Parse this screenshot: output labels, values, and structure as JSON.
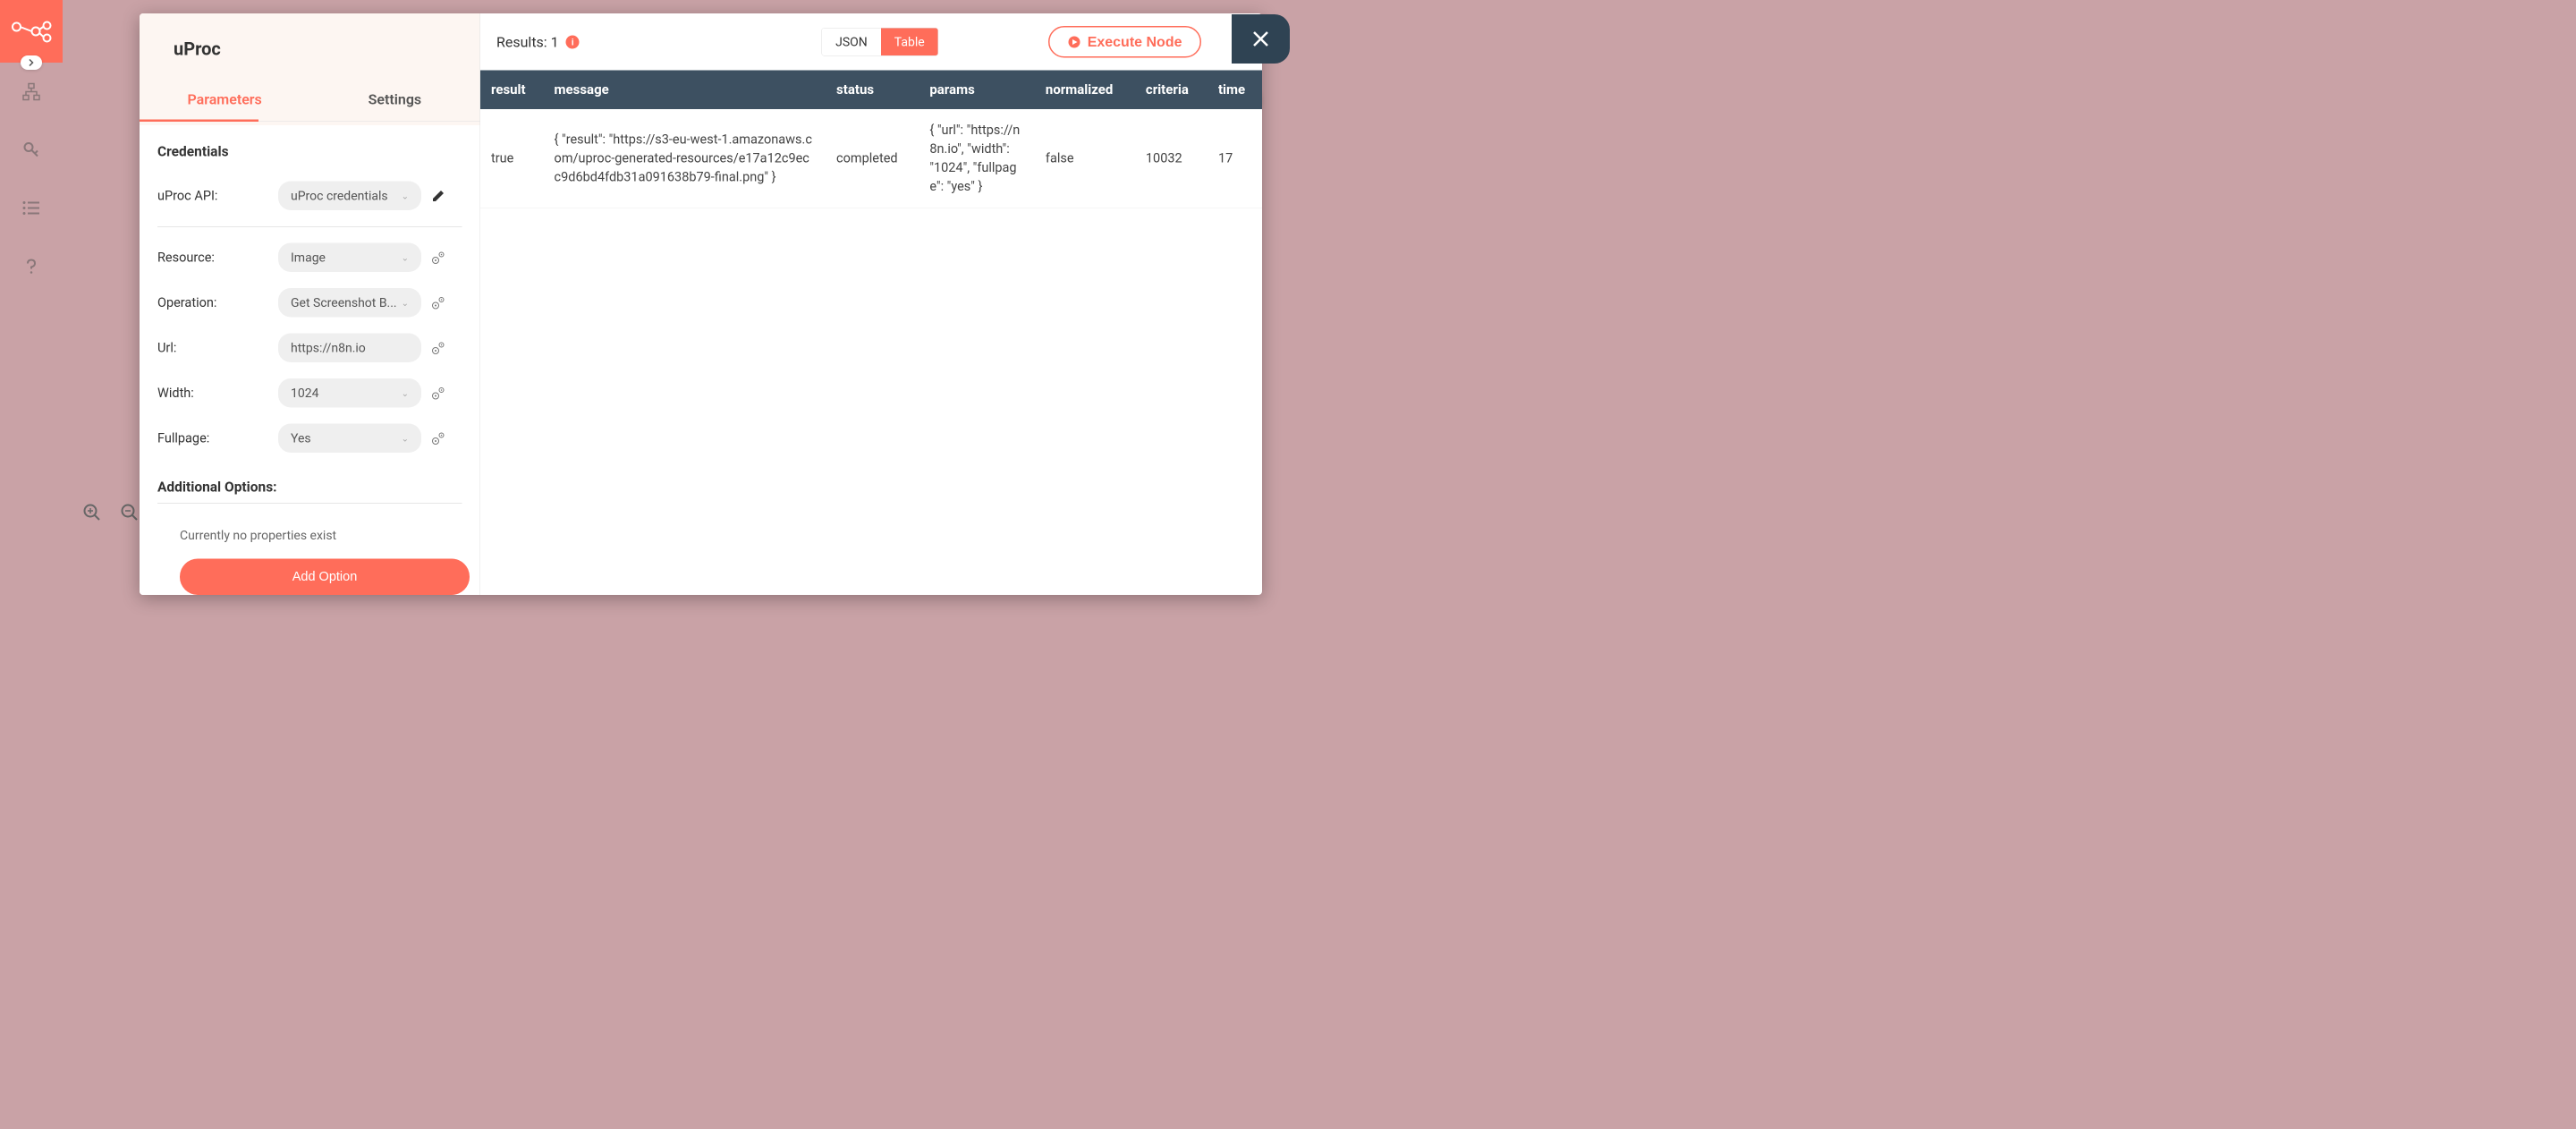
{
  "sidebar": {
    "items": [
      "workflow",
      "hierarchy",
      "credentials",
      "executions",
      "help"
    ]
  },
  "modal": {
    "title": "uProc",
    "tabs": {
      "parameters": "Parameters",
      "settings": "Settings"
    },
    "credentials": {
      "section_label": "Credentials",
      "api_label": "uProc API:",
      "api_value": "uProc credentials"
    },
    "fields": {
      "resource": {
        "label": "Resource:",
        "value": "Image"
      },
      "operation": {
        "label": "Operation:",
        "value": "Get Screenshot B..."
      },
      "url": {
        "label": "Url:",
        "value": "https://n8n.io"
      },
      "width": {
        "label": "Width:",
        "value": "1024"
      },
      "fullpage": {
        "label": "Fullpage:",
        "value": "Yes"
      }
    },
    "additional": {
      "label": "Additional Options:",
      "empty_text": "Currently no properties exist",
      "add_button": "Add Option"
    }
  },
  "results": {
    "label": "Results: 1",
    "view_json": "JSON",
    "view_table": "Table",
    "execute_button": "Execute Node",
    "columns": [
      "result",
      "message",
      "status",
      "params",
      "normalized",
      "criteria",
      "time"
    ],
    "rows": [
      {
        "result": "true",
        "message": "{ \"result\": \"https://s3-eu-west-1.amazonaws.com/uproc-generated-resources/e17a12c9ecc9d6bd4fdb31a091638b79-final.png\" }",
        "status": "completed",
        "params": "{ \"url\": \"https://n8n.io\", \"width\": \"1024\", \"fullpage\": \"yes\" }",
        "normalized": "false",
        "criteria": "10032",
        "time": "17"
      }
    ]
  }
}
